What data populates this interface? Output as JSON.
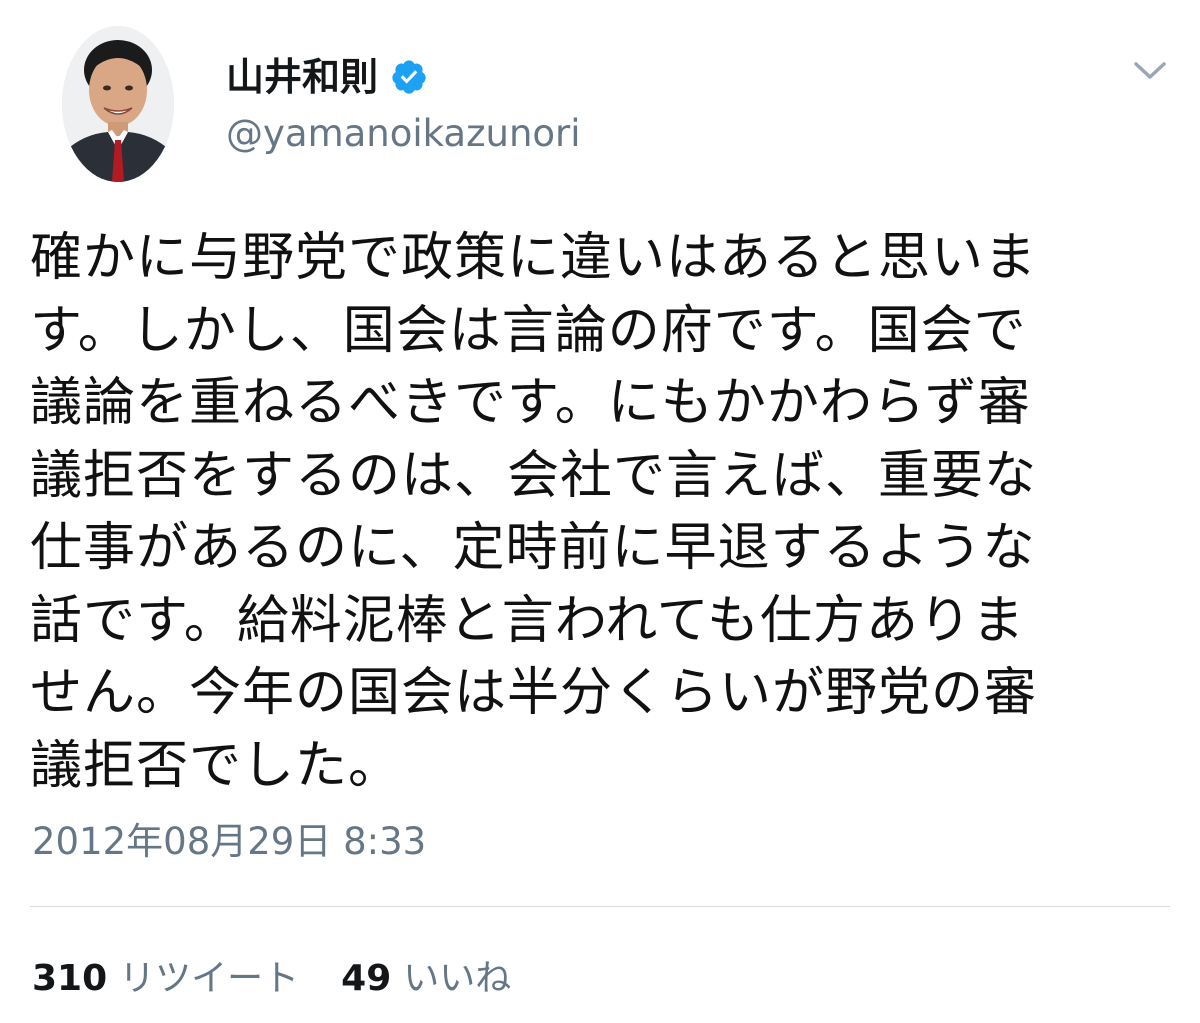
{
  "user": {
    "display_name": "山井和則",
    "handle": "@yamanoikazunori",
    "verified": true,
    "verified_color": "#1da1f2"
  },
  "tweet": {
    "lines": [
      "確かに与野党で政策に違いはあると思いま",
      "す。しかし、国会は言論の府です。国会で",
      "議論を重ねるべきです。にもかかわらず審",
      "議拒否をするのは、会社で言えば、重要な",
      "仕事があるのに、定時前に早退するような",
      "話です。給料泥棒と言われても仕方ありま",
      "せん。今年の国会は半分くらいが野党の審",
      "議拒否でした。"
    ],
    "timestamp": "2012年08月29日 8:33"
  },
  "stats": {
    "retweets_count": "310",
    "retweets_label": "リツイート",
    "likes_count": "49",
    "likes_label": "いいね"
  },
  "icons": {
    "menu": "chevron-down-icon",
    "verified": "verified-badge-icon"
  },
  "colors": {
    "secondary_text": "#657786",
    "primary_text": "#14171a",
    "divider": "#d8dde2"
  }
}
